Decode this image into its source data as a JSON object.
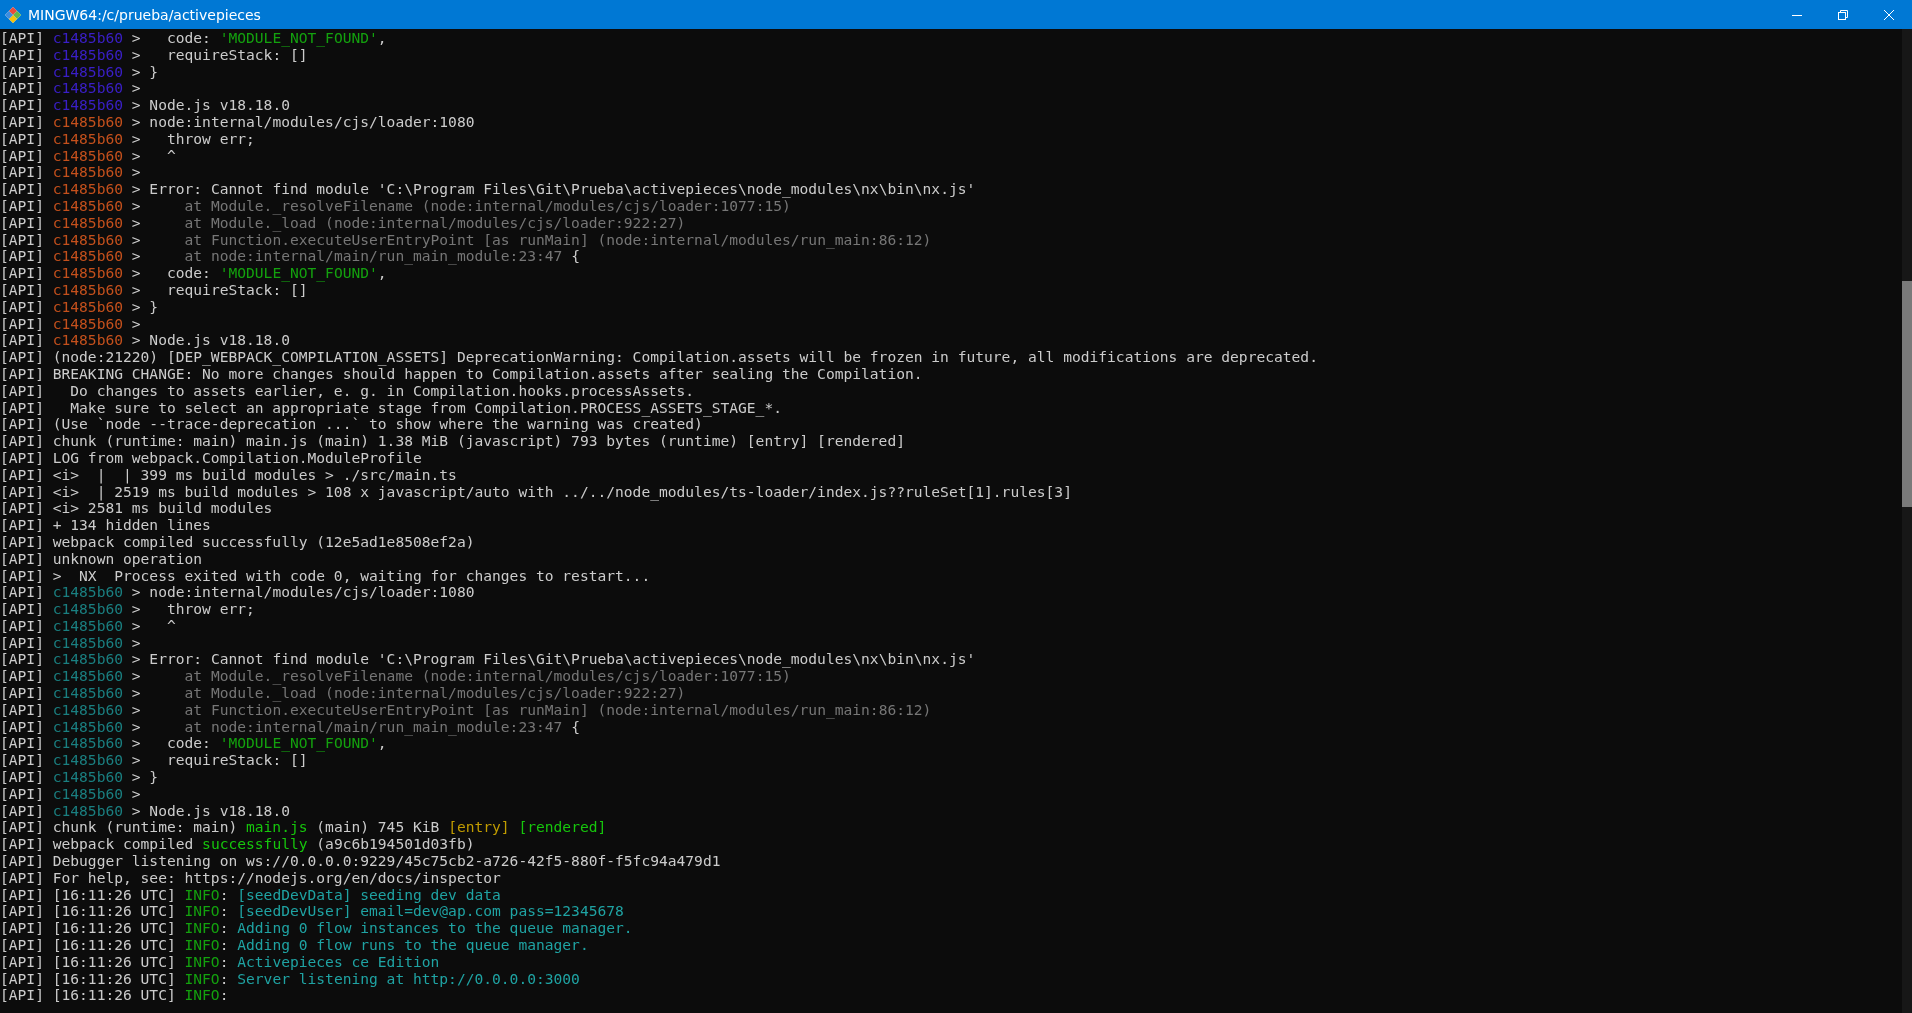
{
  "window": {
    "title": "MINGW64:/c/prueba/activepieces"
  },
  "lines": [
    {
      "segments": [
        {
          "text": "[API]",
          "color": "#cccccc"
        },
        {
          "text": " c1485b60",
          "color": "#3a1fc8"
        },
        {
          "text": " >   code: ",
          "color": "#cccccc"
        },
        {
          "text": "'MODULE_NOT_FOUND'",
          "color": "#13a10e"
        },
        {
          "text": ",",
          "color": "#cccccc"
        }
      ]
    },
    {
      "segments": [
        {
          "text": "[API]",
          "color": "#cccccc"
        },
        {
          "text": " c1485b60",
          "color": "#3a1fc8"
        },
        {
          "text": " >   requireStack: []",
          "color": "#cccccc"
        }
      ]
    },
    {
      "segments": [
        {
          "text": "[API]",
          "color": "#cccccc"
        },
        {
          "text": " c1485b60",
          "color": "#3a1fc8"
        },
        {
          "text": " > }",
          "color": "#cccccc"
        }
      ]
    },
    {
      "segments": [
        {
          "text": "[API]",
          "color": "#cccccc"
        },
        {
          "text": " c1485b60",
          "color": "#3a1fc8"
        },
        {
          "text": " >",
          "color": "#cccccc"
        }
      ]
    },
    {
      "segments": [
        {
          "text": "[API]",
          "color": "#cccccc"
        },
        {
          "text": " c1485b60",
          "color": "#3a1fc8"
        },
        {
          "text": " > Node.js v18.18.0",
          "color": "#cccccc"
        }
      ]
    },
    {
      "segments": [
        {
          "text": "[API]",
          "color": "#cccccc"
        },
        {
          "text": " c1485b60",
          "color": "#c4501c"
        },
        {
          "text": " > node:internal/modules/cjs/loader:1080",
          "color": "#cccccc"
        }
      ]
    },
    {
      "segments": [
        {
          "text": "[API]",
          "color": "#cccccc"
        },
        {
          "text": " c1485b60",
          "color": "#c4501c"
        },
        {
          "text": " >   throw err;",
          "color": "#cccccc"
        }
      ]
    },
    {
      "segments": [
        {
          "text": "[API]",
          "color": "#cccccc"
        },
        {
          "text": " c1485b60",
          "color": "#c4501c"
        },
        {
          "text": " >   ^",
          "color": "#cccccc"
        }
      ]
    },
    {
      "segments": [
        {
          "text": "[API]",
          "color": "#cccccc"
        },
        {
          "text": " c1485b60",
          "color": "#c4501c"
        },
        {
          "text": " >",
          "color": "#cccccc"
        }
      ]
    },
    {
      "segments": [
        {
          "text": "[API]",
          "color": "#cccccc"
        },
        {
          "text": " c1485b60",
          "color": "#c4501c"
        },
        {
          "text": " > Error: Cannot find module 'C:\\Program Files\\Git\\Prueba\\activepieces\\node_modules\\nx\\bin\\nx.js'",
          "color": "#cccccc"
        }
      ]
    },
    {
      "segments": [
        {
          "text": "[API]",
          "color": "#cccccc"
        },
        {
          "text": " c1485b60",
          "color": "#c4501c"
        },
        {
          "text": " >",
          "color": "#cccccc"
        },
        {
          "text": "     at Module._resolveFilename (node:internal/modules/cjs/loader:1077:15)",
          "color": "#767676"
        }
      ]
    },
    {
      "segments": [
        {
          "text": "[API]",
          "color": "#cccccc"
        },
        {
          "text": " c1485b60",
          "color": "#c4501c"
        },
        {
          "text": " >",
          "color": "#cccccc"
        },
        {
          "text": "     at Module._load (node:internal/modules/cjs/loader:922:27)",
          "color": "#767676"
        }
      ]
    },
    {
      "segments": [
        {
          "text": "[API]",
          "color": "#cccccc"
        },
        {
          "text": " c1485b60",
          "color": "#c4501c"
        },
        {
          "text": " >",
          "color": "#cccccc"
        },
        {
          "text": "     at Function.executeUserEntryPoint [as runMain] (node:internal/modules/run_main:86:12)",
          "color": "#767676"
        }
      ]
    },
    {
      "segments": [
        {
          "text": "[API]",
          "color": "#cccccc"
        },
        {
          "text": " c1485b60",
          "color": "#c4501c"
        },
        {
          "text": " >",
          "color": "#cccccc"
        },
        {
          "text": "     at node:internal/main/run_main_module:23:47",
          "color": "#767676"
        },
        {
          "text": " {",
          "color": "#cccccc"
        }
      ]
    },
    {
      "segments": [
        {
          "text": "[API]",
          "color": "#cccccc"
        },
        {
          "text": " c1485b60",
          "color": "#c4501c"
        },
        {
          "text": " >   code: ",
          "color": "#cccccc"
        },
        {
          "text": "'MODULE_NOT_FOUND'",
          "color": "#13a10e"
        },
        {
          "text": ",",
          "color": "#cccccc"
        }
      ]
    },
    {
      "segments": [
        {
          "text": "[API]",
          "color": "#cccccc"
        },
        {
          "text": " c1485b60",
          "color": "#c4501c"
        },
        {
          "text": " >   requireStack: []",
          "color": "#cccccc"
        }
      ]
    },
    {
      "segments": [
        {
          "text": "[API]",
          "color": "#cccccc"
        },
        {
          "text": " c1485b60",
          "color": "#c4501c"
        },
        {
          "text": " > }",
          "color": "#cccccc"
        }
      ]
    },
    {
      "segments": [
        {
          "text": "[API]",
          "color": "#cccccc"
        },
        {
          "text": " c1485b60",
          "color": "#c4501c"
        },
        {
          "text": " >",
          "color": "#cccccc"
        }
      ]
    },
    {
      "segments": [
        {
          "text": "[API]",
          "color": "#cccccc"
        },
        {
          "text": " c1485b60",
          "color": "#c4501c"
        },
        {
          "text": " > Node.js v18.18.0",
          "color": "#cccccc"
        }
      ]
    },
    {
      "segments": [
        {
          "text": "[API] (node:21220) [DEP_WEBPACK_COMPILATION_ASSETS] DeprecationWarning: Compilation.assets will be frozen in future, all modifications are deprecated.",
          "color": "#cccccc"
        }
      ]
    },
    {
      "segments": [
        {
          "text": "[API] BREAKING CHANGE: No more changes should happen to Compilation.assets after sealing the Compilation.",
          "color": "#cccccc"
        }
      ]
    },
    {
      "segments": [
        {
          "text": "[API]   Do changes to assets earlier, e. g. in Compilation.hooks.processAssets.",
          "color": "#cccccc"
        }
      ]
    },
    {
      "segments": [
        {
          "text": "[API]   Make sure to select an appropriate stage from Compilation.PROCESS_ASSETS_STAGE_*.",
          "color": "#cccccc"
        }
      ]
    },
    {
      "segments": [
        {
          "text": "[API] (Use `node --trace-deprecation ...` to show where the warning was created)",
          "color": "#cccccc"
        }
      ]
    },
    {
      "segments": [
        {
          "text": "[API] chunk (runtime: main) main.js (main) 1.38 MiB (javascript) 793 bytes (runtime) [entry] [rendered]",
          "color": "#cccccc"
        }
      ]
    },
    {
      "segments": [
        {
          "text": "[API] LOG from webpack.Compilation.ModuleProfile",
          "color": "#cccccc"
        }
      ]
    },
    {
      "segments": [
        {
          "text": "[API] <i>  |  | 399 ms build modules > ./src/main.ts",
          "color": "#cccccc"
        }
      ]
    },
    {
      "segments": [
        {
          "text": "[API] <i>  | 2519 ms build modules > 108 x javascript/auto with ../../node_modules/ts-loader/index.js??ruleSet[1].rules[3]",
          "color": "#cccccc"
        }
      ]
    },
    {
      "segments": [
        {
          "text": "[API] <i> 2581 ms build modules",
          "color": "#cccccc"
        }
      ]
    },
    {
      "segments": [
        {
          "text": "[API] + 134 hidden lines",
          "color": "#cccccc"
        }
      ]
    },
    {
      "segments": [
        {
          "text": "[API] webpack compiled successfully (12e5ad1e8508ef2a)",
          "color": "#cccccc"
        }
      ]
    },
    {
      "segments": [
        {
          "text": "[API] unknown operation",
          "color": "#cccccc"
        }
      ]
    },
    {
      "segments": [
        {
          "text": "[API] >  NX  Process exited with code 0, waiting for changes to restart...",
          "color": "#cccccc"
        }
      ]
    },
    {
      "segments": [
        {
          "text": "[API]",
          "color": "#cccccc"
        },
        {
          "text": " c1485b60",
          "color": "#1a7f80"
        },
        {
          "text": " > node:internal/modules/cjs/loader:1080",
          "color": "#cccccc"
        }
      ]
    },
    {
      "segments": [
        {
          "text": "[API]",
          "color": "#cccccc"
        },
        {
          "text": " c1485b60",
          "color": "#1a7f80"
        },
        {
          "text": " >   throw err;",
          "color": "#cccccc"
        }
      ]
    },
    {
      "segments": [
        {
          "text": "[API]",
          "color": "#cccccc"
        },
        {
          "text": " c1485b60",
          "color": "#1a7f80"
        },
        {
          "text": " >   ^",
          "color": "#cccccc"
        }
      ]
    },
    {
      "segments": [
        {
          "text": "[API]",
          "color": "#cccccc"
        },
        {
          "text": " c1485b60",
          "color": "#1a7f80"
        },
        {
          "text": " >",
          "color": "#cccccc"
        }
      ]
    },
    {
      "segments": [
        {
          "text": "[API]",
          "color": "#cccccc"
        },
        {
          "text": " c1485b60",
          "color": "#1a7f80"
        },
        {
          "text": " > Error: Cannot find module 'C:\\Program Files\\Git\\Prueba\\activepieces\\node_modules\\nx\\bin\\nx.js'",
          "color": "#cccccc"
        }
      ]
    },
    {
      "segments": [
        {
          "text": "[API]",
          "color": "#cccccc"
        },
        {
          "text": " c1485b60",
          "color": "#1a7f80"
        },
        {
          "text": " >",
          "color": "#cccccc"
        },
        {
          "text": "     at Module._resolveFilename (node:internal/modules/cjs/loader:1077:15)",
          "color": "#767676"
        }
      ]
    },
    {
      "segments": [
        {
          "text": "[API]",
          "color": "#cccccc"
        },
        {
          "text": " c1485b60",
          "color": "#1a7f80"
        },
        {
          "text": " >",
          "color": "#cccccc"
        },
        {
          "text": "     at Module._load (node:internal/modules/cjs/loader:922:27)",
          "color": "#767676"
        }
      ]
    },
    {
      "segments": [
        {
          "text": "[API]",
          "color": "#cccccc"
        },
        {
          "text": " c1485b60",
          "color": "#1a7f80"
        },
        {
          "text": " >",
          "color": "#cccccc"
        },
        {
          "text": "     at Function.executeUserEntryPoint [as runMain] (node:internal/modules/run_main:86:12)",
          "color": "#767676"
        }
      ]
    },
    {
      "segments": [
        {
          "text": "[API]",
          "color": "#cccccc"
        },
        {
          "text": " c1485b60",
          "color": "#1a7f80"
        },
        {
          "text": " >",
          "color": "#cccccc"
        },
        {
          "text": "     at node:internal/main/run_main_module:23:47",
          "color": "#767676"
        },
        {
          "text": " {",
          "color": "#cccccc"
        }
      ]
    },
    {
      "segments": [
        {
          "text": "[API]",
          "color": "#cccccc"
        },
        {
          "text": " c1485b60",
          "color": "#1a7f80"
        },
        {
          "text": " >   code: ",
          "color": "#cccccc"
        },
        {
          "text": "'MODULE_NOT_FOUND'",
          "color": "#13a10e"
        },
        {
          "text": ",",
          "color": "#cccccc"
        }
      ]
    },
    {
      "segments": [
        {
          "text": "[API]",
          "color": "#cccccc"
        },
        {
          "text": " c1485b60",
          "color": "#1a7f80"
        },
        {
          "text": " >   requireStack: []",
          "color": "#cccccc"
        }
      ]
    },
    {
      "segments": [
        {
          "text": "[API]",
          "color": "#cccccc"
        },
        {
          "text": " c1485b60",
          "color": "#1a7f80"
        },
        {
          "text": " > }",
          "color": "#cccccc"
        }
      ]
    },
    {
      "segments": [
        {
          "text": "[API]",
          "color": "#cccccc"
        },
        {
          "text": " c1485b60",
          "color": "#1a7f80"
        },
        {
          "text": " >",
          "color": "#cccccc"
        }
      ]
    },
    {
      "segments": [
        {
          "text": "[API]",
          "color": "#cccccc"
        },
        {
          "text": " c1485b60",
          "color": "#1a7f80"
        },
        {
          "text": " > Node.js v18.18.0",
          "color": "#cccccc"
        }
      ]
    },
    {
      "segments": [
        {
          "text": "[API] chunk (runtime: main) ",
          "color": "#cccccc"
        },
        {
          "text": "main.js",
          "color": "#16c60c"
        },
        {
          "text": " (main) 745 KiB ",
          "color": "#cccccc"
        },
        {
          "text": "[entry]",
          "color": "#c19c00"
        },
        {
          "text": " [rendered]",
          "color": "#16c60c"
        }
      ]
    },
    {
      "segments": [
        {
          "text": "[API] webpack compiled ",
          "color": "#cccccc"
        },
        {
          "text": "successfully",
          "color": "#16c60c"
        },
        {
          "text": " (a9c6b194501d03fb)",
          "color": "#cccccc"
        }
      ]
    },
    {
      "segments": [
        {
          "text": "[API] Debugger listening on ws://0.0.0.0:9229/45c75cb2-a726-42f5-880f-f5fc94a479d1",
          "color": "#cccccc"
        }
      ]
    },
    {
      "segments": [
        {
          "text": "[API] For help, see: https://nodejs.org/en/docs/inspector",
          "color": "#cccccc"
        }
      ]
    },
    {
      "segments": [
        {
          "text": "[API] [16:11:26 UTC] ",
          "color": "#cccccc"
        },
        {
          "text": "INFO",
          "color": "#13a10e"
        },
        {
          "text": ": ",
          "color": "#cccccc"
        },
        {
          "text": "[seedDevData] seeding dev data",
          "color": "#1fa3a3"
        }
      ]
    },
    {
      "segments": [
        {
          "text": "[API] [16:11:26 UTC] ",
          "color": "#cccccc"
        },
        {
          "text": "INFO",
          "color": "#13a10e"
        },
        {
          "text": ": ",
          "color": "#cccccc"
        },
        {
          "text": "[seedDevUser] email=dev@ap.com pass=12345678",
          "color": "#1fa3a3"
        }
      ]
    },
    {
      "segments": [
        {
          "text": "[API] [16:11:26 UTC] ",
          "color": "#cccccc"
        },
        {
          "text": "INFO",
          "color": "#13a10e"
        },
        {
          "text": ": ",
          "color": "#cccccc"
        },
        {
          "text": "Adding 0 flow instances to the queue manager.",
          "color": "#1fa3a3"
        }
      ]
    },
    {
      "segments": [
        {
          "text": "[API] [16:11:26 UTC] ",
          "color": "#cccccc"
        },
        {
          "text": "INFO",
          "color": "#13a10e"
        },
        {
          "text": ": ",
          "color": "#cccccc"
        },
        {
          "text": "Adding 0 flow runs to the queue manager.",
          "color": "#1fa3a3"
        }
      ]
    },
    {
      "segments": [
        {
          "text": "[API] [16:11:26 UTC] ",
          "color": "#cccccc"
        },
        {
          "text": "INFO",
          "color": "#13a10e"
        },
        {
          "text": ": ",
          "color": "#cccccc"
        },
        {
          "text": "Activepieces ce Edition",
          "color": "#1fa3a3"
        }
      ]
    },
    {
      "segments": [
        {
          "text": "[API] [16:11:26 UTC] ",
          "color": "#cccccc"
        },
        {
          "text": "INFO",
          "color": "#13a10e"
        },
        {
          "text": ": ",
          "color": "#cccccc"
        },
        {
          "text": "Server listening at http://0.0.0.0:3000",
          "color": "#1fa3a3"
        }
      ]
    },
    {
      "segments": [
        {
          "text": "[API] [16:11:26 UTC] ",
          "color": "#cccccc"
        },
        {
          "text": "INFO",
          "color": "#13a10e"
        },
        {
          "text": ":",
          "color": "#cccccc"
        }
      ]
    }
  ]
}
